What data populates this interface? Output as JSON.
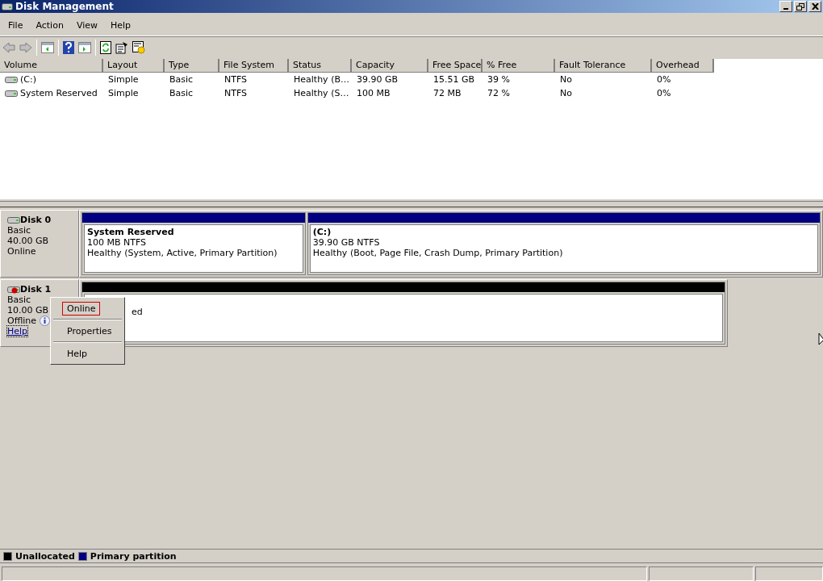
{
  "window": {
    "title": "Disk Management"
  },
  "menu": [
    "File",
    "Action",
    "View",
    "Help"
  ],
  "toolbar": [
    {
      "kind": "back",
      "disabled": true
    },
    {
      "kind": "forward",
      "disabled": true
    },
    {
      "kind": "sep"
    },
    {
      "kind": "console"
    },
    {
      "kind": "sep"
    },
    {
      "kind": "help"
    },
    {
      "kind": "pane"
    },
    {
      "kind": "sep"
    },
    {
      "kind": "refresh"
    },
    {
      "kind": "properties"
    },
    {
      "kind": "settings"
    }
  ],
  "table": {
    "columns": [
      "Volume",
      "Layout",
      "Type",
      "File System",
      "Status",
      "Capacity",
      "Free Space",
      "% Free",
      "Fault Tolerance",
      "Overhead"
    ],
    "rows": [
      [
        "(C:)",
        "Simple",
        "Basic",
        "NTFS",
        "Healthy (B…",
        "39.90 GB",
        "15.51 GB",
        "39 %",
        "No",
        "0%"
      ],
      [
        "System Reserved",
        "Simple",
        "Basic",
        "NTFS",
        "Healthy (S…",
        "100 MB",
        "72 MB",
        "72 %",
        "No",
        "0%"
      ]
    ]
  },
  "disks": [
    {
      "name": "Disk 0",
      "kind": "online",
      "lines": [
        "Basic",
        "40.00 GB",
        "Online"
      ],
      "partitions": [
        {
          "kind": "primary",
          "title": "System Reserved",
          "lines": [
            "100 MB NTFS",
            "Healthy (System, Active, Primary Partition)"
          ]
        },
        {
          "kind": "primary",
          "title": "(C:)",
          "lines": [
            "39.90 GB NTFS",
            "Healthy (Boot, Page File, Crash Dump, Primary Partition)"
          ]
        }
      ]
    },
    {
      "name": "Disk 1",
      "kind": "offline",
      "lines": [
        "Basic",
        "10.00 GB",
        "Offline"
      ],
      "help": "Help",
      "partitions": [
        {
          "kind": "unallocated",
          "lines": [
            "ed"
          ]
        }
      ]
    }
  ],
  "context_menu": [
    {
      "kind": "item",
      "label": "Online",
      "selected": true
    },
    {
      "kind": "sep"
    },
    {
      "kind": "item",
      "label": "Properties",
      "selected": false
    },
    {
      "kind": "sep"
    },
    {
      "kind": "item",
      "label": "Help",
      "selected": false
    }
  ],
  "legend": [
    {
      "label": "Unallocated",
      "color": "#000000"
    },
    {
      "label": "Primary partition",
      "color": "#000080"
    }
  ]
}
